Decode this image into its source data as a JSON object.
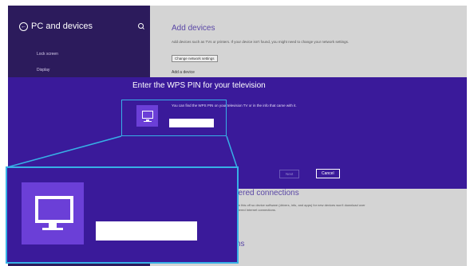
{
  "sidebar": {
    "title": "PC and devices",
    "back_icon": "back-arrow-icon",
    "search_icon": "search-icon",
    "items": [
      "Lock screen",
      "Display"
    ]
  },
  "content": {
    "add_title": "Add devices",
    "add_desc": "Add devices such as TVs or printers. If your device isn't found, you might need to change your network settings.",
    "change_button": "Change network settings",
    "add_device": "Add a device",
    "metered_title": "dered connections",
    "metered_desc": "Turn this off so device software (drivers, info, and apps) for new devices won't download over metered Internet connections.",
    "cut_text": "ns"
  },
  "dialog": {
    "title": "Enter the WPS PIN for your television",
    "description": "You can find the WPS PIN on your television TV or in the info that came with it.",
    "pin_value": "",
    "next_button": "Next",
    "cancel_button": "Cancel",
    "device_icon": "monitor-icon"
  },
  "colors": {
    "dialog_bg": "#3a1a9a",
    "sidebar_bg": "#2c1b5c",
    "tile": "#6b3fd7",
    "highlight": "#37b0e6",
    "accent_text": "#5a47a6"
  }
}
